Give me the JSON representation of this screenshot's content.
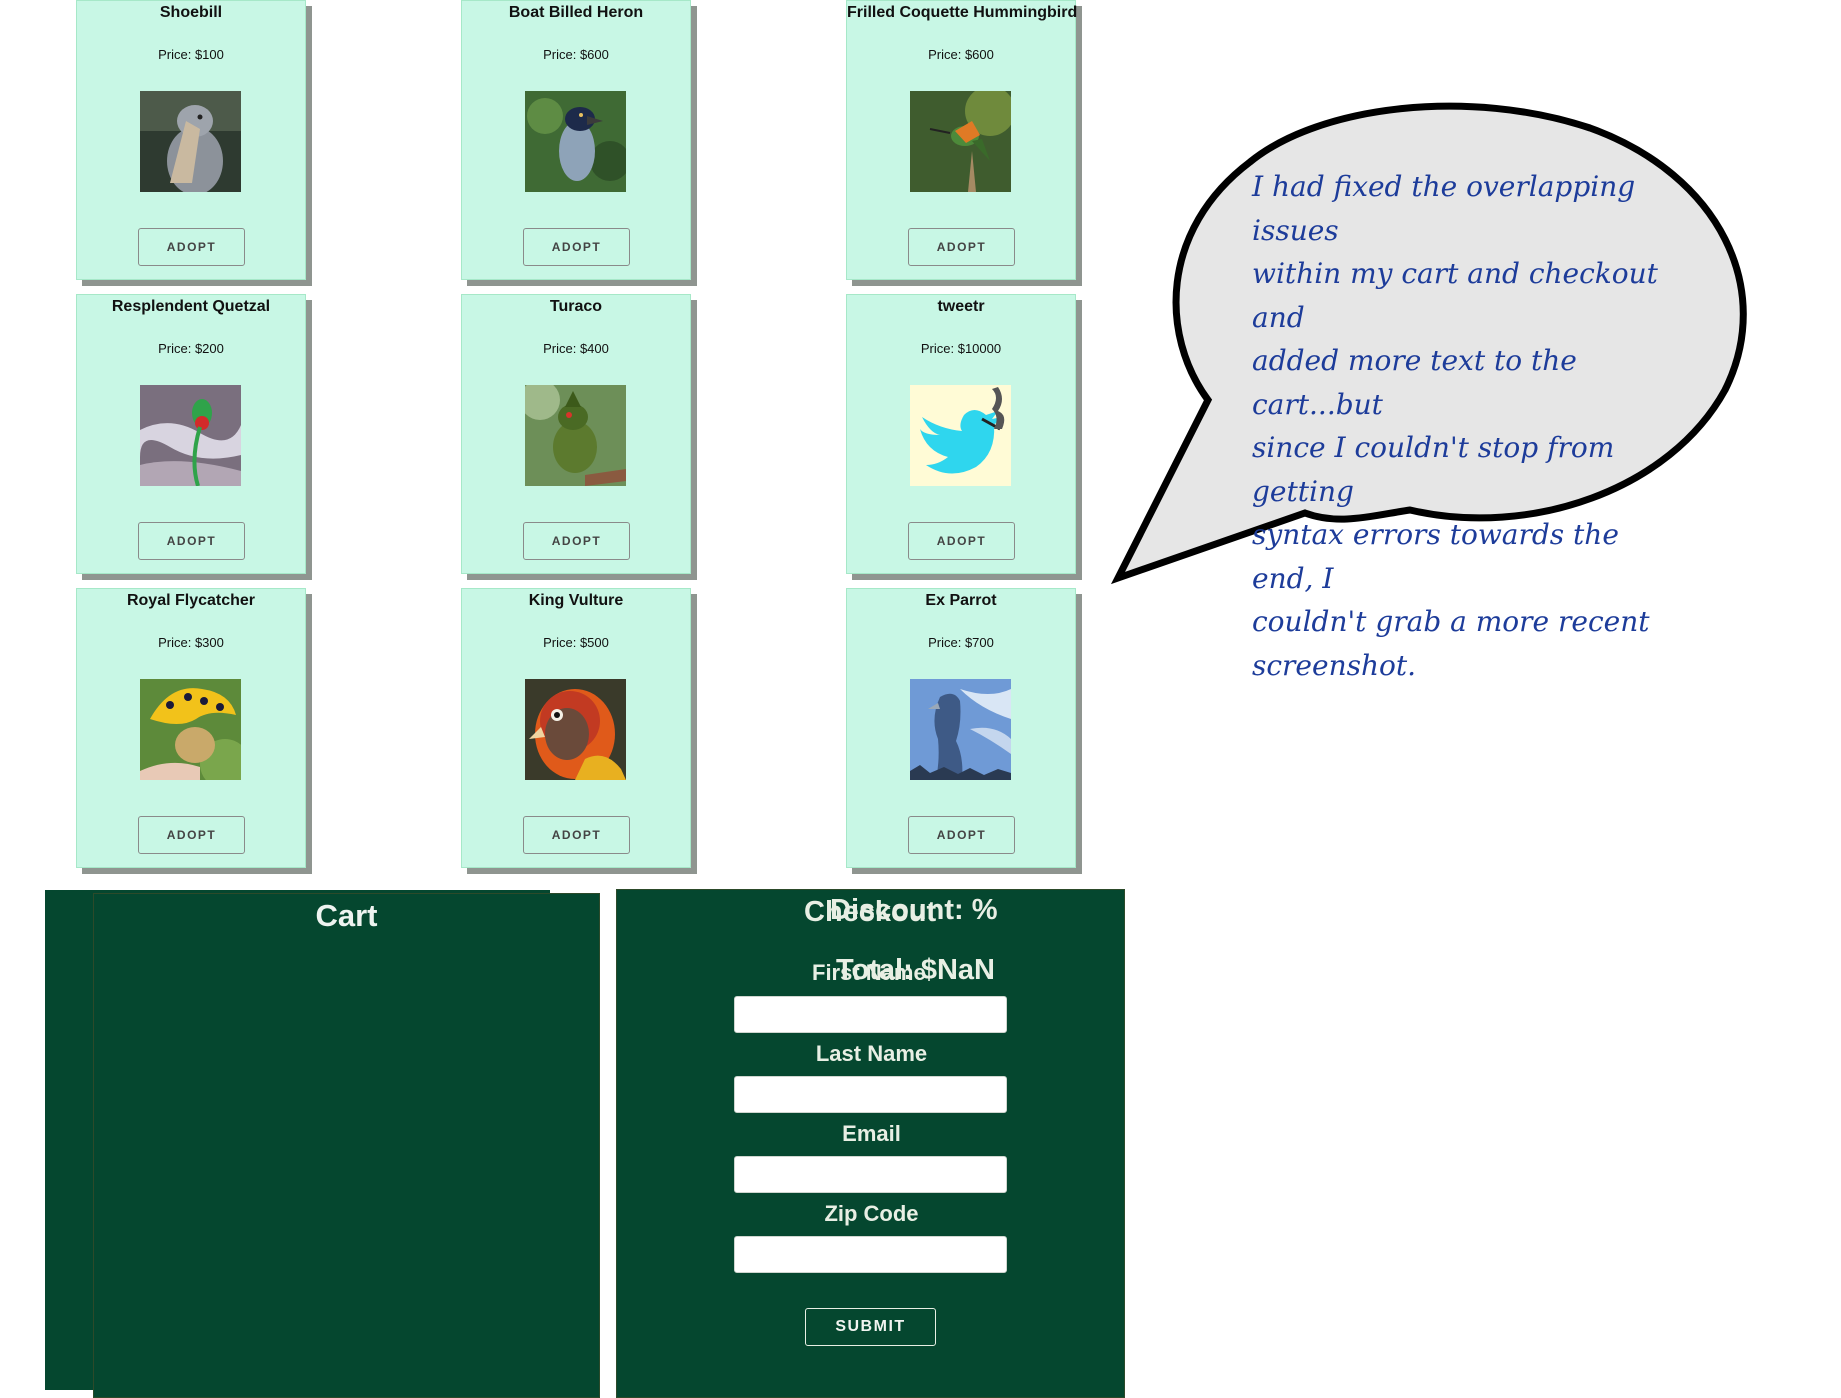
{
  "products": [
    {
      "name": "Shoebill",
      "price": "Price: $100",
      "button": "ADOPT",
      "image": "shoebill-photo"
    },
    {
      "name": "Boat Billed Heron",
      "price": "Price: $600",
      "button": "ADOPT",
      "image": "boat-billed-heron-photo"
    },
    {
      "name": "Frilled Coquette Hummingbird",
      "price": "Price: $600",
      "button": "ADOPT",
      "image": "frilled-coquette-photo"
    },
    {
      "name": "Resplendent Quetzal",
      "price": "Price: $200",
      "button": "ADOPT",
      "image": "resplendent-quetzal-photo"
    },
    {
      "name": "Turaco",
      "price": "Price: $400",
      "button": "ADOPT",
      "image": "turaco-photo"
    },
    {
      "name": "tweetr",
      "price": "Price: $10000",
      "button": "ADOPT",
      "image": "tweetr-photo"
    },
    {
      "name": "Royal Flycatcher",
      "price": "Price: $300",
      "button": "ADOPT",
      "image": "royal-flycatcher-photo"
    },
    {
      "name": "King Vulture",
      "price": "Price: $500",
      "button": "ADOPT",
      "image": "king-vulture-photo"
    },
    {
      "name": "Ex Parrot",
      "price": "Price: $700",
      "button": "ADOPT",
      "image": "ex-parrot-photo"
    }
  ],
  "speech_bubble": {
    "lines": [
      "I had fixed the overlapping issues",
      "within my cart and checkout and",
      "added more text to the cart...but",
      "since I couldn't stop from getting",
      "syntax errors towards the end, I",
      "couldn't grab a more recent",
      "screenshot."
    ],
    "fill_color": "#e6e6e6",
    "text_color": "#1d3c9a"
  },
  "cart": {
    "title": "Cart"
  },
  "checkout": {
    "title": "Checkout",
    "discount": "Discount: %",
    "total": "Total: $NaN",
    "fields": [
      {
        "label": "First Name",
        "value": ""
      },
      {
        "label": "Last Name",
        "value": ""
      },
      {
        "label": "Email",
        "value": ""
      },
      {
        "label": "Zip Code",
        "value": ""
      }
    ],
    "submit": "SUBMIT"
  },
  "colors": {
    "card_bg": "#c8f7e5",
    "panel_bg": "#05472f",
    "panel_text": "#e8efe4"
  }
}
